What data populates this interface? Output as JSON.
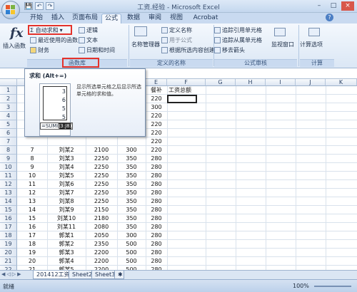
{
  "window": {
    "title": "工资.经验 - Microsoft Excel",
    "minimize": "–",
    "maximize": "□",
    "close": "×"
  },
  "quick_access": [
    "💾",
    "↶",
    "↷"
  ],
  "tabs": [
    {
      "label": "开始",
      "active": false
    },
    {
      "label": "插入",
      "active": false
    },
    {
      "label": "页面布局",
      "active": false
    },
    {
      "label": "公式",
      "active": true
    },
    {
      "label": "数据",
      "active": false
    },
    {
      "label": "审阅",
      "active": false
    },
    {
      "label": "视图",
      "active": false
    },
    {
      "label": "Acrobat",
      "active": false
    }
  ],
  "ribbon": {
    "insert_function": "插入函数",
    "library": {
      "autosum": "Σ 自动求和",
      "recent": "最近使用的函数",
      "finance": "财务",
      "logical": "逻辑",
      "text": "文本",
      "datetime": "日期和时间",
      "label": "函数库"
    },
    "names": {
      "name_manager": "名称管理器",
      "define_name": "定义名称",
      "use_in_formula": "用于公式",
      "create_from_selection": "根据所选内容创建",
      "label": "定义的名称"
    },
    "audit": {
      "trace_precedents": "追踪引用单元格",
      "trace_dependents": "追踪从属单元格",
      "remove_arrows": "移去箭头",
      "watch_window": "监视窗口",
      "label": "公式审核"
    },
    "calc": {
      "options": "计算选项",
      "label": "计算"
    }
  },
  "tooltip": {
    "title": "求和 (Alt+=)",
    "description": "显示所选单元格之后显示所选单元格的求和值。",
    "preview_values": [
      "3",
      "6",
      "5",
      "5"
    ],
    "preview_formula": "=SUM(",
    "preview_range": "J3:J8)"
  },
  "grid": {
    "columns": [
      "A",
      "B",
      "C",
      "D",
      "E",
      "F",
      "G",
      "H",
      "I",
      "J",
      "K"
    ],
    "header_row": {
      "e_label": "餐补",
      "f_label": "工资总额"
    },
    "rows": [
      {
        "n": "1",
        "a": "",
        "b": "",
        "c": "",
        "d": "",
        "e": ""
      },
      {
        "n": "2",
        "a": "",
        "b": "",
        "c": "",
        "d": "",
        "e": "220"
      },
      {
        "n": "3",
        "a": "",
        "b": "",
        "c": "",
        "d": "",
        "e": "300"
      },
      {
        "n": "4",
        "a": "",
        "b": "",
        "c": "",
        "d": "",
        "e": "220"
      },
      {
        "n": "5",
        "a": "",
        "b": "",
        "c": "",
        "d": "",
        "e": "220"
      },
      {
        "n": "6",
        "a": "",
        "b": "",
        "c": "",
        "d": "",
        "e": "220"
      },
      {
        "n": "7",
        "a": "",
        "b": "",
        "c": "",
        "d": "",
        "e": "220"
      },
      {
        "n": "8",
        "a": "7",
        "b": "刘某2",
        "c": "2100",
        "d": "300",
        "e": "220"
      },
      {
        "n": "9",
        "a": "8",
        "b": "刘某3",
        "c": "2250",
        "d": "350",
        "e": "280"
      },
      {
        "n": "10",
        "a": "9",
        "b": "刘某4",
        "c": "2250",
        "d": "350",
        "e": "280"
      },
      {
        "n": "11",
        "a": "10",
        "b": "刘某5",
        "c": "2250",
        "d": "350",
        "e": "280"
      },
      {
        "n": "12",
        "a": "11",
        "b": "刘某6",
        "c": "2250",
        "d": "350",
        "e": "280"
      },
      {
        "n": "13",
        "a": "12",
        "b": "刘某7",
        "c": "2250",
        "d": "350",
        "e": "280"
      },
      {
        "n": "14",
        "a": "13",
        "b": "刘某8",
        "c": "2250",
        "d": "350",
        "e": "280"
      },
      {
        "n": "15",
        "a": "14",
        "b": "刘某9",
        "c": "2150",
        "d": "350",
        "e": "280"
      },
      {
        "n": "16",
        "a": "15",
        "b": "刘某10",
        "c": "2180",
        "d": "350",
        "e": "280"
      },
      {
        "n": "17",
        "a": "16",
        "b": "刘某11",
        "c": "2080",
        "d": "350",
        "e": "280"
      },
      {
        "n": "18",
        "a": "17",
        "b": "郭某1",
        "c": "2050",
        "d": "300",
        "e": "280"
      },
      {
        "n": "19",
        "a": "18",
        "b": "郭某2",
        "c": "2350",
        "d": "500",
        "e": "280"
      },
      {
        "n": "20",
        "a": "19",
        "b": "郭某3",
        "c": "2200",
        "d": "500",
        "e": "280"
      },
      {
        "n": "21",
        "a": "20",
        "b": "郭某4",
        "c": "2200",
        "d": "500",
        "e": "280"
      },
      {
        "n": "22",
        "a": "21",
        "b": "郭某5",
        "c": "2200",
        "d": "500",
        "e": "280"
      },
      {
        "n": "23",
        "a": "22",
        "b": "郭某6",
        "c": "2200",
        "d": "500",
        "e": "280"
      },
      {
        "n": "24",
        "a": "23",
        "b": "郭某7",
        "c": "2200",
        "d": "500",
        "e": "280"
      }
    ]
  },
  "sheets": {
    "tabs": [
      "201412工资",
      "Sheet2",
      "Sheet3"
    ],
    "nav": [
      "◀",
      "◁",
      "▷",
      "▶"
    ]
  },
  "status": {
    "ready": "就绪",
    "zoom": "100%"
  }
}
